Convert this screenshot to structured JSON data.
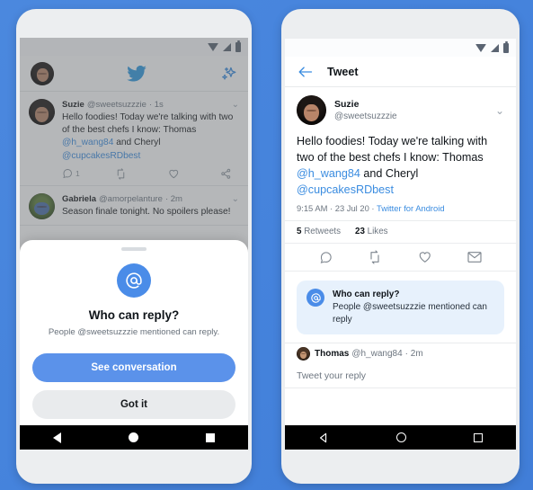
{
  "background_color": "#4583dc",
  "accent_blue": "#3a8ce0",
  "button_blue": "#5b92ea",
  "left_phone": {
    "name": "twitter-home-with-who-can-reply-sheet",
    "statusbar": {
      "wifi": "wifi-icon",
      "signal": "signal-icon",
      "battery": "battery-icon"
    },
    "home_header": {
      "avatar": "user-avatar",
      "logo": "twitter-bird-icon",
      "sparkle": "sparkle-icon"
    },
    "timeline": [
      {
        "name": "Suzie",
        "handle": "@sweetsuzzzie",
        "time": "1s",
        "text_parts": [
          {
            "t": "Hello foodies! Today we're talking with two of the best chefs I know: Thomas ",
            "mention": false
          },
          {
            "t": "@h_wang84",
            "mention": true
          },
          {
            "t": " and Cheryl ",
            "mention": false
          },
          {
            "t": "@cupcakesRDbest",
            "mention": true
          }
        ],
        "actions": {
          "reply_count": "1",
          "retweet_count": "",
          "like_count": "",
          "share": "share-icon"
        }
      },
      {
        "name": "Gabriela",
        "handle": "@amorpelanture",
        "time": "2m",
        "text": "Season finale tonight. No spoilers please!"
      }
    ],
    "sheet": {
      "icon": "at-mention-icon",
      "title": "Who can reply?",
      "subtitle": "People @sweetsuzzzie mentioned can reply.",
      "primary_button": "See conversation",
      "secondary_button": "Got it"
    },
    "navbar": {
      "back": "back-triangle-icon",
      "home": "home-circle-icon",
      "recents": "recents-square-icon"
    }
  },
  "right_phone": {
    "name": "tweet-detail-view",
    "statusbar": {
      "wifi": "wifi-icon",
      "signal": "signal-icon",
      "battery": "battery-icon"
    },
    "header": {
      "back": "back-arrow-icon",
      "title": "Tweet"
    },
    "tweet": {
      "name": "Suzie",
      "handle": "@sweetsuzzzie",
      "caret": "chevron-down-icon",
      "text_parts": [
        {
          "t": "Hello foodies! Today we're talking with two of the best chefs I know: Thomas ",
          "mention": false
        },
        {
          "t": "@h_wang84",
          "mention": true
        },
        {
          "t": " and Cheryl ",
          "mention": false
        },
        {
          "t": "@cupcakesRDbest",
          "mention": true
        }
      ],
      "time": "9:15 AM",
      "date": "23 Jul 20",
      "source": "Twitter for Android",
      "retweets_value": "5",
      "retweets_label": "Retweets",
      "likes_value": "23",
      "likes_label": "Likes",
      "actions": [
        "reply-icon",
        "retweet-icon",
        "like-icon",
        "dm-icon"
      ]
    },
    "info_card": {
      "icon": "at-mention-icon",
      "title": "Who can reply?",
      "body": "People @sweetsuzzzie mentioned can reply"
    },
    "reply": {
      "name": "Thomas",
      "handle": "@h_wang84",
      "time": "2m",
      "compose_placeholder": "Tweet your reply"
    },
    "navbar": {
      "back": "back-triangle-outline-icon",
      "home": "home-circle-outline-icon",
      "recents": "recents-square-outline-icon"
    }
  }
}
